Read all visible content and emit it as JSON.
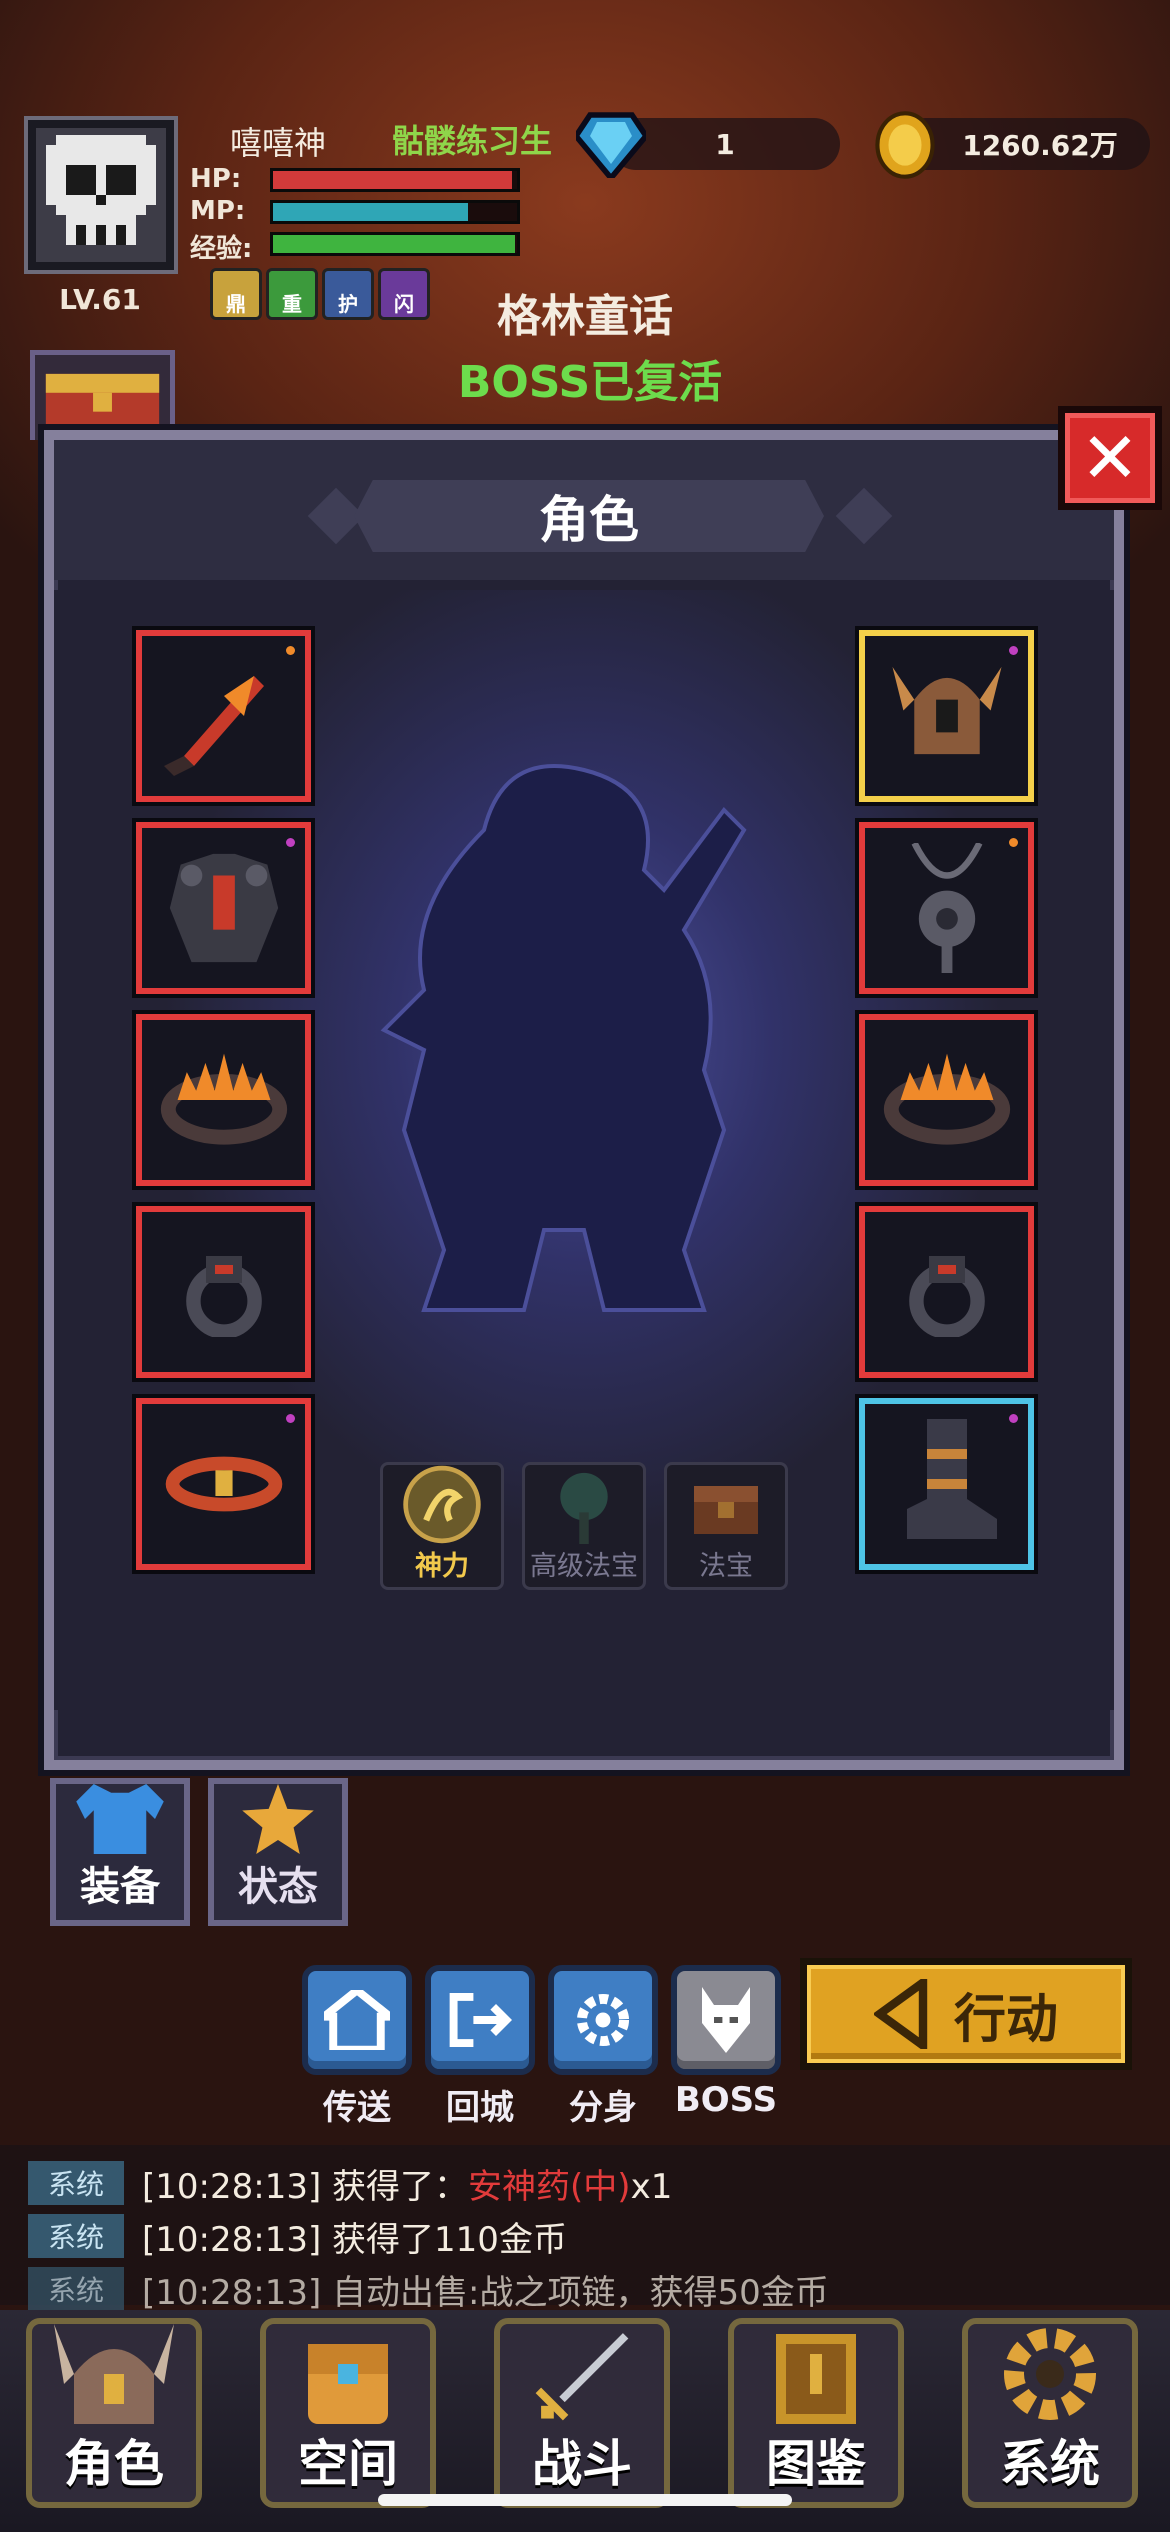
{
  "player": {
    "name": "嘻嘻神",
    "title": "骷髅练习生",
    "level": "LV.61",
    "stats": [
      {
        "label": "HP:",
        "fraction": 0.98,
        "color": "#d23a3a"
      },
      {
        "label": "MP:",
        "fraction": 0.8,
        "color": "#2fa6b6"
      },
      {
        "label": "经验:",
        "fraction": 0.99,
        "color": "#3fb43f"
      }
    ],
    "buffs": [
      {
        "label": "鼎",
        "icon": "fist-icon",
        "color": "#c8a23c"
      },
      {
        "label": "重",
        "icon": "weight-icon",
        "color": "#3c9a3c"
      },
      {
        "label": "护",
        "icon": "shield-icon",
        "color": "#3a5a9a"
      },
      {
        "label": "闪",
        "icon": "flash-icon",
        "color": "#6a3a9a"
      }
    ]
  },
  "currency": {
    "gems": "1",
    "gold": "1260.62万"
  },
  "location": {
    "map_name": "格林童话",
    "boss_status": "BOSS已复活"
  },
  "panel": {
    "title": "角色",
    "left_slots": [
      {
        "name": "weapon-slot",
        "icon": "flame-sword-icon",
        "border": "red",
        "dot": "#f08a2a"
      },
      {
        "name": "armor-slot",
        "icon": "dark-armor-icon",
        "border": "red",
        "dot": "#c040c0"
      },
      {
        "name": "crown-slot",
        "icon": "fire-ring-icon",
        "border": "red",
        "dot": ""
      },
      {
        "name": "ring-slot",
        "icon": "dark-ring-icon",
        "border": "red",
        "dot": ""
      },
      {
        "name": "belt-slot",
        "icon": "fire-belt-icon",
        "border": "red",
        "dot": "#c040c0"
      }
    ],
    "right_slots": [
      {
        "name": "helmet-slot",
        "icon": "horned-helmet-icon",
        "border": "gold",
        "dot": "#c040c0"
      },
      {
        "name": "necklace-slot",
        "icon": "amulet-icon",
        "border": "red",
        "dot": "#f08a2a"
      },
      {
        "name": "bracelet-slot",
        "icon": "fire-ring-icon",
        "border": "red",
        "dot": ""
      },
      {
        "name": "ring2-slot",
        "icon": "dark-ring-icon",
        "border": "red",
        "dot": ""
      },
      {
        "name": "boots-slot",
        "icon": "boots-icon",
        "border": "cyan",
        "dot": "#c040c0"
      }
    ],
    "treasure_slots": [
      {
        "label": "神力",
        "icon": "dragon-medal-icon",
        "active": true
      },
      {
        "label": "高级法宝",
        "icon": "tree-icon",
        "active": false
      },
      {
        "label": "法宝",
        "icon": "chest-icon",
        "active": false
      }
    ]
  },
  "tabs": [
    {
      "label": "装备",
      "icon": "armor-tab-icon",
      "active": true
    },
    {
      "label": "状态",
      "icon": "star-icon",
      "active": false
    }
  ],
  "actions": [
    {
      "label": "传送",
      "icon": "home-icon"
    },
    {
      "label": "回城",
      "icon": "exit-icon"
    },
    {
      "label": "分身",
      "icon": "gear-icon"
    },
    {
      "label": "BOSS",
      "icon": "demon-icon"
    }
  ],
  "action_button": {
    "label": "行动",
    "icon": "triangle-left-icon"
  },
  "log": [
    {
      "tag": "系统",
      "time": "[10:28:13]",
      "text": "获得了：",
      "highlight": "安神药(中)",
      "suffix": "x1"
    },
    {
      "tag": "系统",
      "time": "[10:28:13]",
      "text": "获得了110金币",
      "highlight": "",
      "suffix": ""
    },
    {
      "tag": "系统",
      "time": "[10:28:13]",
      "text": "自动出售:战之项链，获得50金币",
      "highlight": "",
      "suffix": ""
    }
  ],
  "nav": [
    {
      "label": "角色",
      "icon": "helmet-nav-icon"
    },
    {
      "label": "空间",
      "icon": "backpack-icon"
    },
    {
      "label": "战斗",
      "icon": "sword-icon"
    },
    {
      "label": "图鉴",
      "icon": "book-icon"
    },
    {
      "label": "系统",
      "icon": "gear-icon"
    }
  ]
}
